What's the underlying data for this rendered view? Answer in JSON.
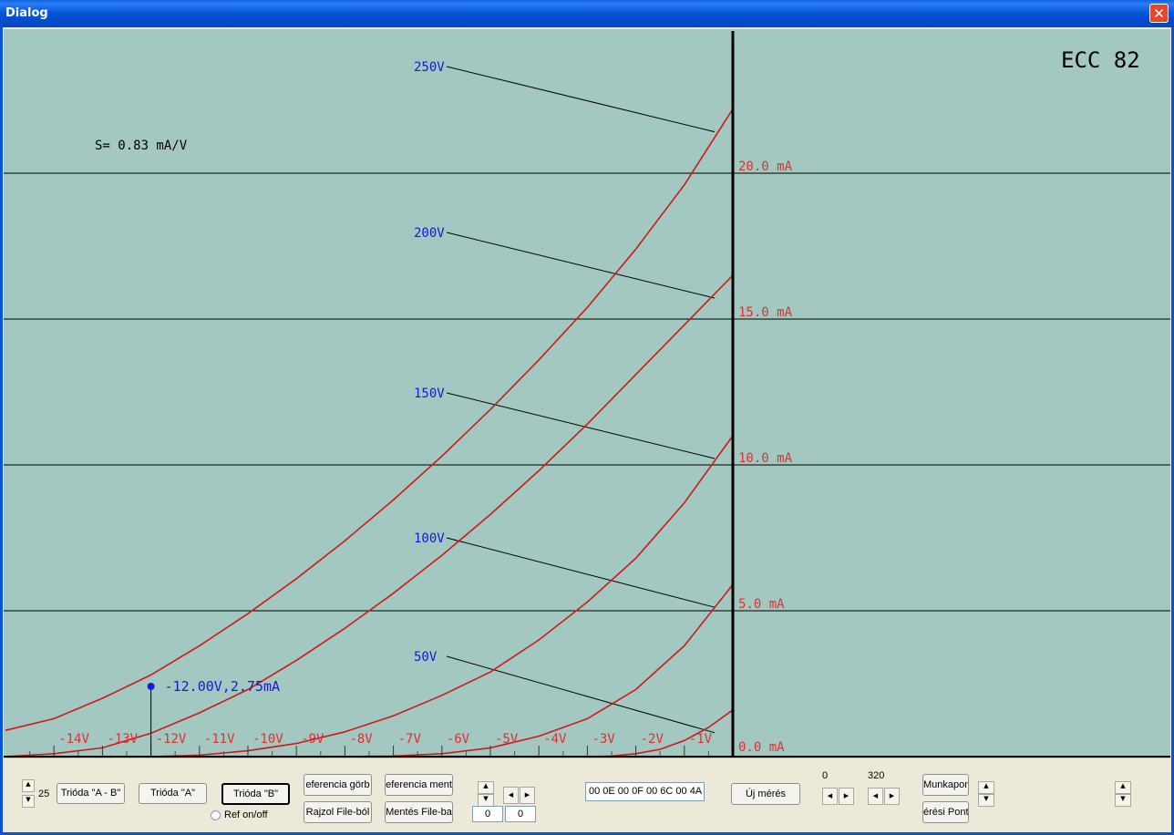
{
  "window": {
    "title": "Dialog",
    "close_glyph": "✕"
  },
  "chart_data": {
    "type": "line",
    "title": "ECC 82",
    "transconductance": "S= 0.83 mA/V",
    "x_range_v": [
      -15,
      0
    ],
    "y_range_ma": [
      0,
      25
    ],
    "x_tick_labels": [
      "-14V",
      "-13V",
      "-12V",
      "-11V",
      "-10V",
      "-9V",
      "-8V",
      "-7V",
      "-6V",
      "-5V",
      "-4V",
      "-3V",
      "-2V",
      "-1V"
    ],
    "y_gridlines_ma": [
      5,
      10,
      15,
      20
    ],
    "y_tick_labels": [
      "20.0 mA",
      "15.0 mA",
      "10.0 mA",
      "5.0 mA",
      "0.0 mA"
    ],
    "cursor": {
      "x": -12.0,
      "y": 2.75,
      "label": "-12.00V,2.75mA"
    },
    "series": [
      {
        "name": "250V",
        "x": [
          -15,
          -14,
          -13,
          -12,
          -11,
          -10,
          -9,
          -8,
          -7,
          -6,
          -5,
          -4,
          -3,
          -2,
          -1,
          0
        ],
        "y": [
          0.9,
          1.3,
          2.0,
          2.8,
          3.8,
          4.9,
          6.1,
          7.4,
          8.8,
          10.3,
          11.9,
          13.6,
          15.4,
          17.4,
          19.6,
          22.2
        ]
      },
      {
        "name": "200V",
        "x": [
          -15,
          -14,
          -13,
          -12,
          -11,
          -10,
          -9,
          -8,
          -7,
          -6,
          -5,
          -4,
          -3,
          -2,
          -1,
          0
        ],
        "y": [
          0.0,
          0.1,
          0.3,
          0.8,
          1.5,
          2.3,
          3.3,
          4.4,
          5.6,
          6.9,
          8.3,
          9.8,
          11.4,
          13.1,
          14.8,
          16.5
        ]
      },
      {
        "name": "150V",
        "x": [
          -12,
          -11,
          -10,
          -9,
          -8,
          -7,
          -6,
          -5,
          -4,
          -3,
          -2,
          -1,
          0
        ],
        "y": [
          0.0,
          0.05,
          0.2,
          0.45,
          0.85,
          1.4,
          2.1,
          2.9,
          4.0,
          5.3,
          6.8,
          8.7,
          11.0
        ]
      },
      {
        "name": "100V",
        "x": [
          -8,
          -7,
          -6,
          -5,
          -4,
          -3,
          -2,
          -1,
          0
        ],
        "y": [
          0.0,
          0.02,
          0.1,
          0.3,
          0.7,
          1.3,
          2.3,
          3.8,
          5.9
        ]
      },
      {
        "name": "50V",
        "x": [
          -3,
          -2.5,
          -2,
          -1.5,
          -1,
          -0.5,
          0
        ],
        "y": [
          0.0,
          0.02,
          0.1,
          0.25,
          0.55,
          1.0,
          1.6
        ]
      }
    ]
  },
  "controls": {
    "counter_value": "25",
    "btn_trioda_ab": "Trióda \"A - B\"",
    "btn_trioda_a": "Trióda  \"A\"",
    "btn_trioda_b": "Trióda  \"B\"",
    "radio_ref": "Ref on/off",
    "btn_ref_gorbe": "eferencia görb",
    "btn_ref_mentes": "eferencia ment",
    "btn_rajzol": "Rajzol File-ból",
    "btn_mentes": "Mentés File-ba",
    "field_a": "0",
    "field_b": "0",
    "hex_field": "00 0E 00 0F 00 6C 00 4A",
    "btn_uj_meres": "Új mérés",
    "label_low": "0",
    "label_high": "320",
    "btn_munkapont": "Munkapon",
    "btn_meresi_pont": "érési Pont",
    "spin_up": "▲",
    "spin_down": "▼",
    "arrow_left": "◀",
    "arrow_right": "▶"
  },
  "colors": {
    "plot_bg": "#a3c7c1",
    "curve": "#cc1a1a",
    "label_red": "#e03030",
    "label_blue": "#1a1acc",
    "dark": "#000000"
  }
}
